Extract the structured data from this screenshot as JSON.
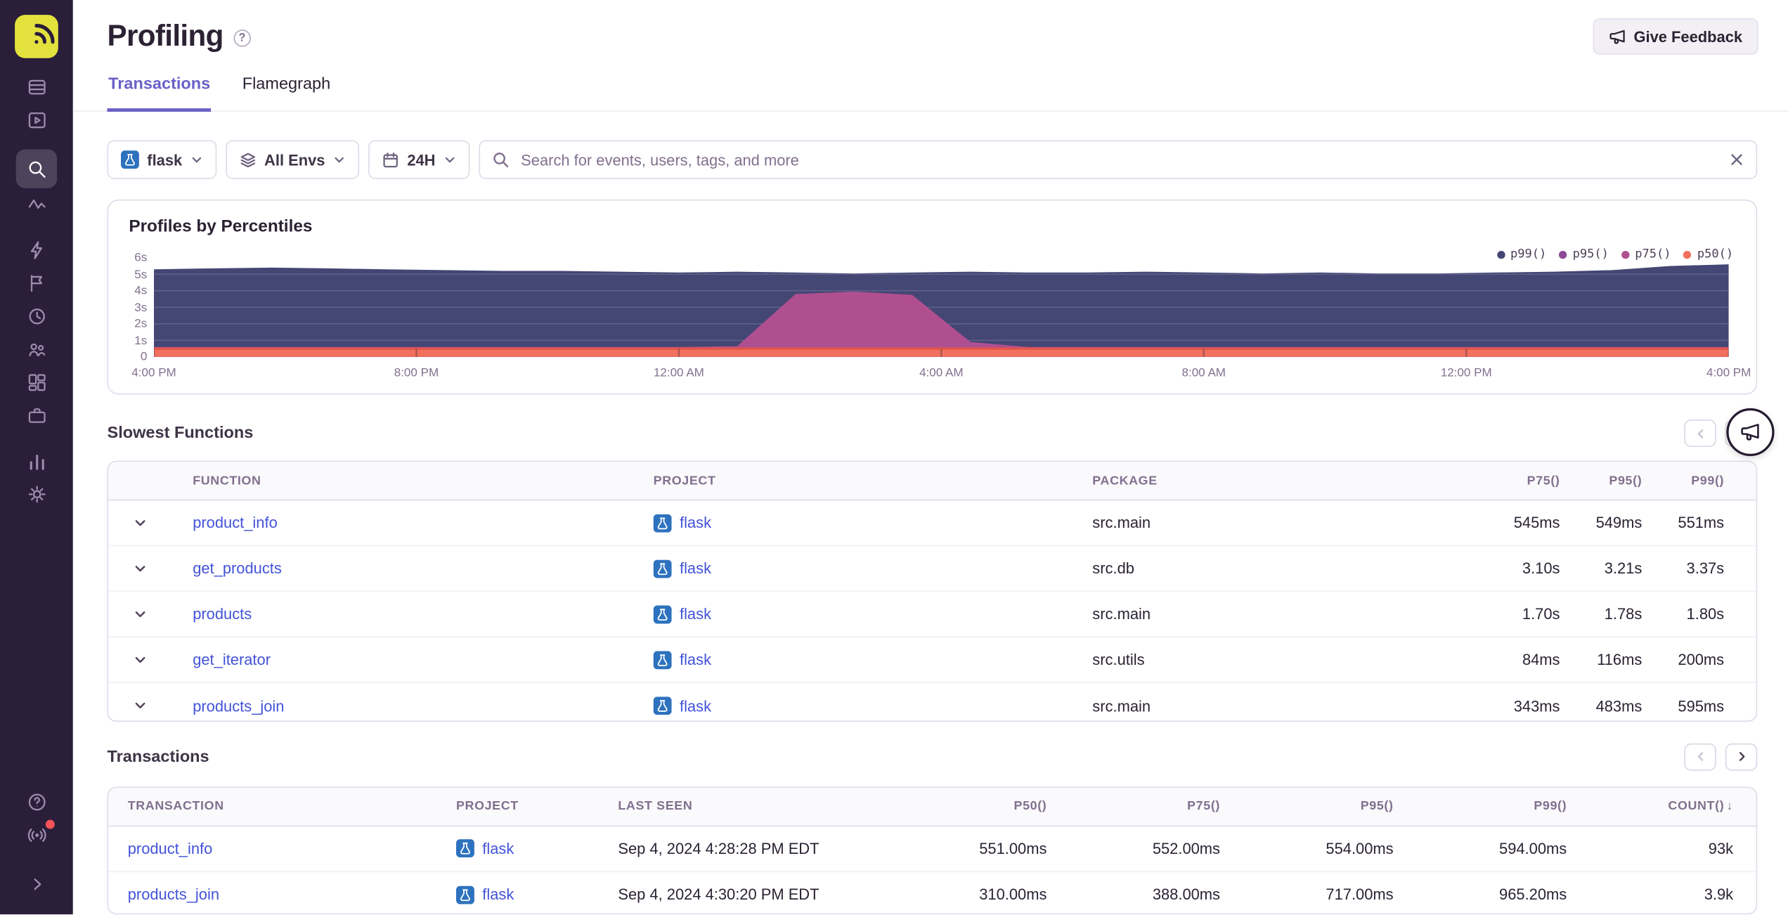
{
  "colors": {
    "accent": "#6c5fc7",
    "link": "#4353d9",
    "border": "#e0dae8",
    "text": "#2b2233",
    "muted": "#80708f",
    "sidebar_bg": "#2a1e3a",
    "logo_bg": "#e3e13d",
    "danger": "#f55459"
  },
  "sidebar": {
    "items": [
      "issues",
      "explore",
      "search",
      "traces",
      "insights",
      "feedback",
      "replays",
      "users",
      "dashboards",
      "projects",
      "stats",
      "settings"
    ],
    "active_item": "search",
    "bottom_items": [
      "help",
      "whats-new",
      "collapse"
    ]
  },
  "header": {
    "title": "Profiling",
    "give_feedback_label": "Give Feedback"
  },
  "tabs": [
    {
      "label": "Transactions",
      "active": true
    },
    {
      "label": "Flamegraph",
      "active": false
    }
  ],
  "filters": {
    "project": {
      "value": "flask"
    },
    "environment": {
      "value": "All Envs"
    },
    "date": {
      "value": "24H"
    },
    "search": {
      "placeholder": "Search for events, users, tags, and more",
      "value": ""
    }
  },
  "chart_data": {
    "type": "area",
    "title": "Profiles by Percentiles",
    "legend_position": "top-right",
    "grid": true,
    "unit": "seconds",
    "ylim": [
      0,
      6
    ],
    "y_labels": [
      "6s",
      "5s",
      "4s",
      "3s",
      "2s",
      "1s",
      "0"
    ],
    "x_labels": [
      "4:00 PM",
      "8:00 PM",
      "12:00 AM",
      "4:00 AM",
      "8:00 AM",
      "12:00 PM",
      "4:00 PM"
    ],
    "series": [
      {
        "name": "p99()",
        "color": "#444674",
        "values": [
          5.3,
          5.35,
          5.4,
          5.35,
          5.3,
          5.25,
          5.2,
          5.2,
          5.15,
          5.1,
          5.15,
          5.1,
          5.05,
          5.1,
          5.15,
          5.1,
          5.1,
          5.15,
          5.1,
          5.05,
          5.1,
          5.05,
          5.05,
          5.1,
          5.15,
          5.25,
          5.5,
          5.6
        ]
      },
      {
        "name": "p95()",
        "color": "#8c4a94",
        "values": [
          5.15,
          5.2,
          5.25,
          5.2,
          5.15,
          5.1,
          5.05,
          5.05,
          5.0,
          4.95,
          5.0,
          4.95,
          4.9,
          4.95,
          5.0,
          4.95,
          4.95,
          5.0,
          4.95,
          4.9,
          4.95,
          4.9,
          4.9,
          4.95,
          5.0,
          5.1,
          5.35,
          5.45
        ]
      },
      {
        "name": "p75()",
        "color": "#b04f90",
        "values": [
          0.6,
          0.6,
          0.6,
          0.6,
          0.6,
          0.6,
          0.6,
          0.6,
          0.6,
          0.6,
          0.65,
          3.8,
          3.95,
          3.75,
          0.9,
          0.6,
          0.6,
          0.6,
          0.6,
          0.6,
          0.6,
          0.6,
          0.6,
          0.6,
          0.6,
          0.6,
          0.6,
          0.6
        ]
      },
      {
        "name": "p50()",
        "color": "#f2705e",
        "stroke": "#e25649",
        "values": [
          0.5,
          0.5,
          0.5,
          0.5,
          0.5,
          0.5,
          0.5,
          0.5,
          0.5,
          0.5,
          0.5,
          0.5,
          0.5,
          0.5,
          0.5,
          0.5,
          0.5,
          0.5,
          0.5,
          0.5,
          0.5,
          0.5,
          0.5,
          0.5,
          0.5,
          0.5,
          0.5,
          0.5
        ]
      }
    ]
  },
  "slowest_functions": {
    "title": "Slowest Functions",
    "columns": [
      "FUNCTION",
      "PROJECT",
      "PACKAGE",
      "P75()",
      "P95()",
      "P99()"
    ],
    "rows": [
      {
        "function": "product_info",
        "project": "flask",
        "package": "src.main",
        "p75": "545ms",
        "p95": "549ms",
        "p99": "551ms"
      },
      {
        "function": "get_products",
        "project": "flask",
        "package": "src.db",
        "p75": "3.10s",
        "p95": "3.21s",
        "p99": "3.37s"
      },
      {
        "function": "products",
        "project": "flask",
        "package": "src.main",
        "p75": "1.70s",
        "p95": "1.78s",
        "p99": "1.80s"
      },
      {
        "function": "get_iterator",
        "project": "flask",
        "package": "src.utils",
        "p75": "84ms",
        "p95": "116ms",
        "p99": "200ms"
      },
      {
        "function": "products_join",
        "project": "flask",
        "package": "src.main",
        "p75": "343ms",
        "p95": "483ms",
        "p99": "595ms"
      }
    ]
  },
  "transactions": {
    "title": "Transactions",
    "columns": [
      "TRANSACTION",
      "PROJECT",
      "LAST SEEN",
      "P50()",
      "P75()",
      "P95()",
      "P99()",
      "COUNT()"
    ],
    "sort": {
      "column": "COUNT()",
      "direction": "desc"
    },
    "rows": [
      {
        "transaction": "product_info",
        "project": "flask",
        "last_seen": "Sep 4, 2024 4:28:28 PM EDT",
        "p50": "551.00ms",
        "p75": "552.00ms",
        "p95": "554.00ms",
        "p99": "594.00ms",
        "count": "93k"
      },
      {
        "transaction": "products_join",
        "project": "flask",
        "last_seen": "Sep 4, 2024 4:30:20 PM EDT",
        "p50": "310.00ms",
        "p75": "388.00ms",
        "p95": "717.00ms",
        "p99": "965.20ms",
        "count": "3.9k"
      }
    ]
  }
}
